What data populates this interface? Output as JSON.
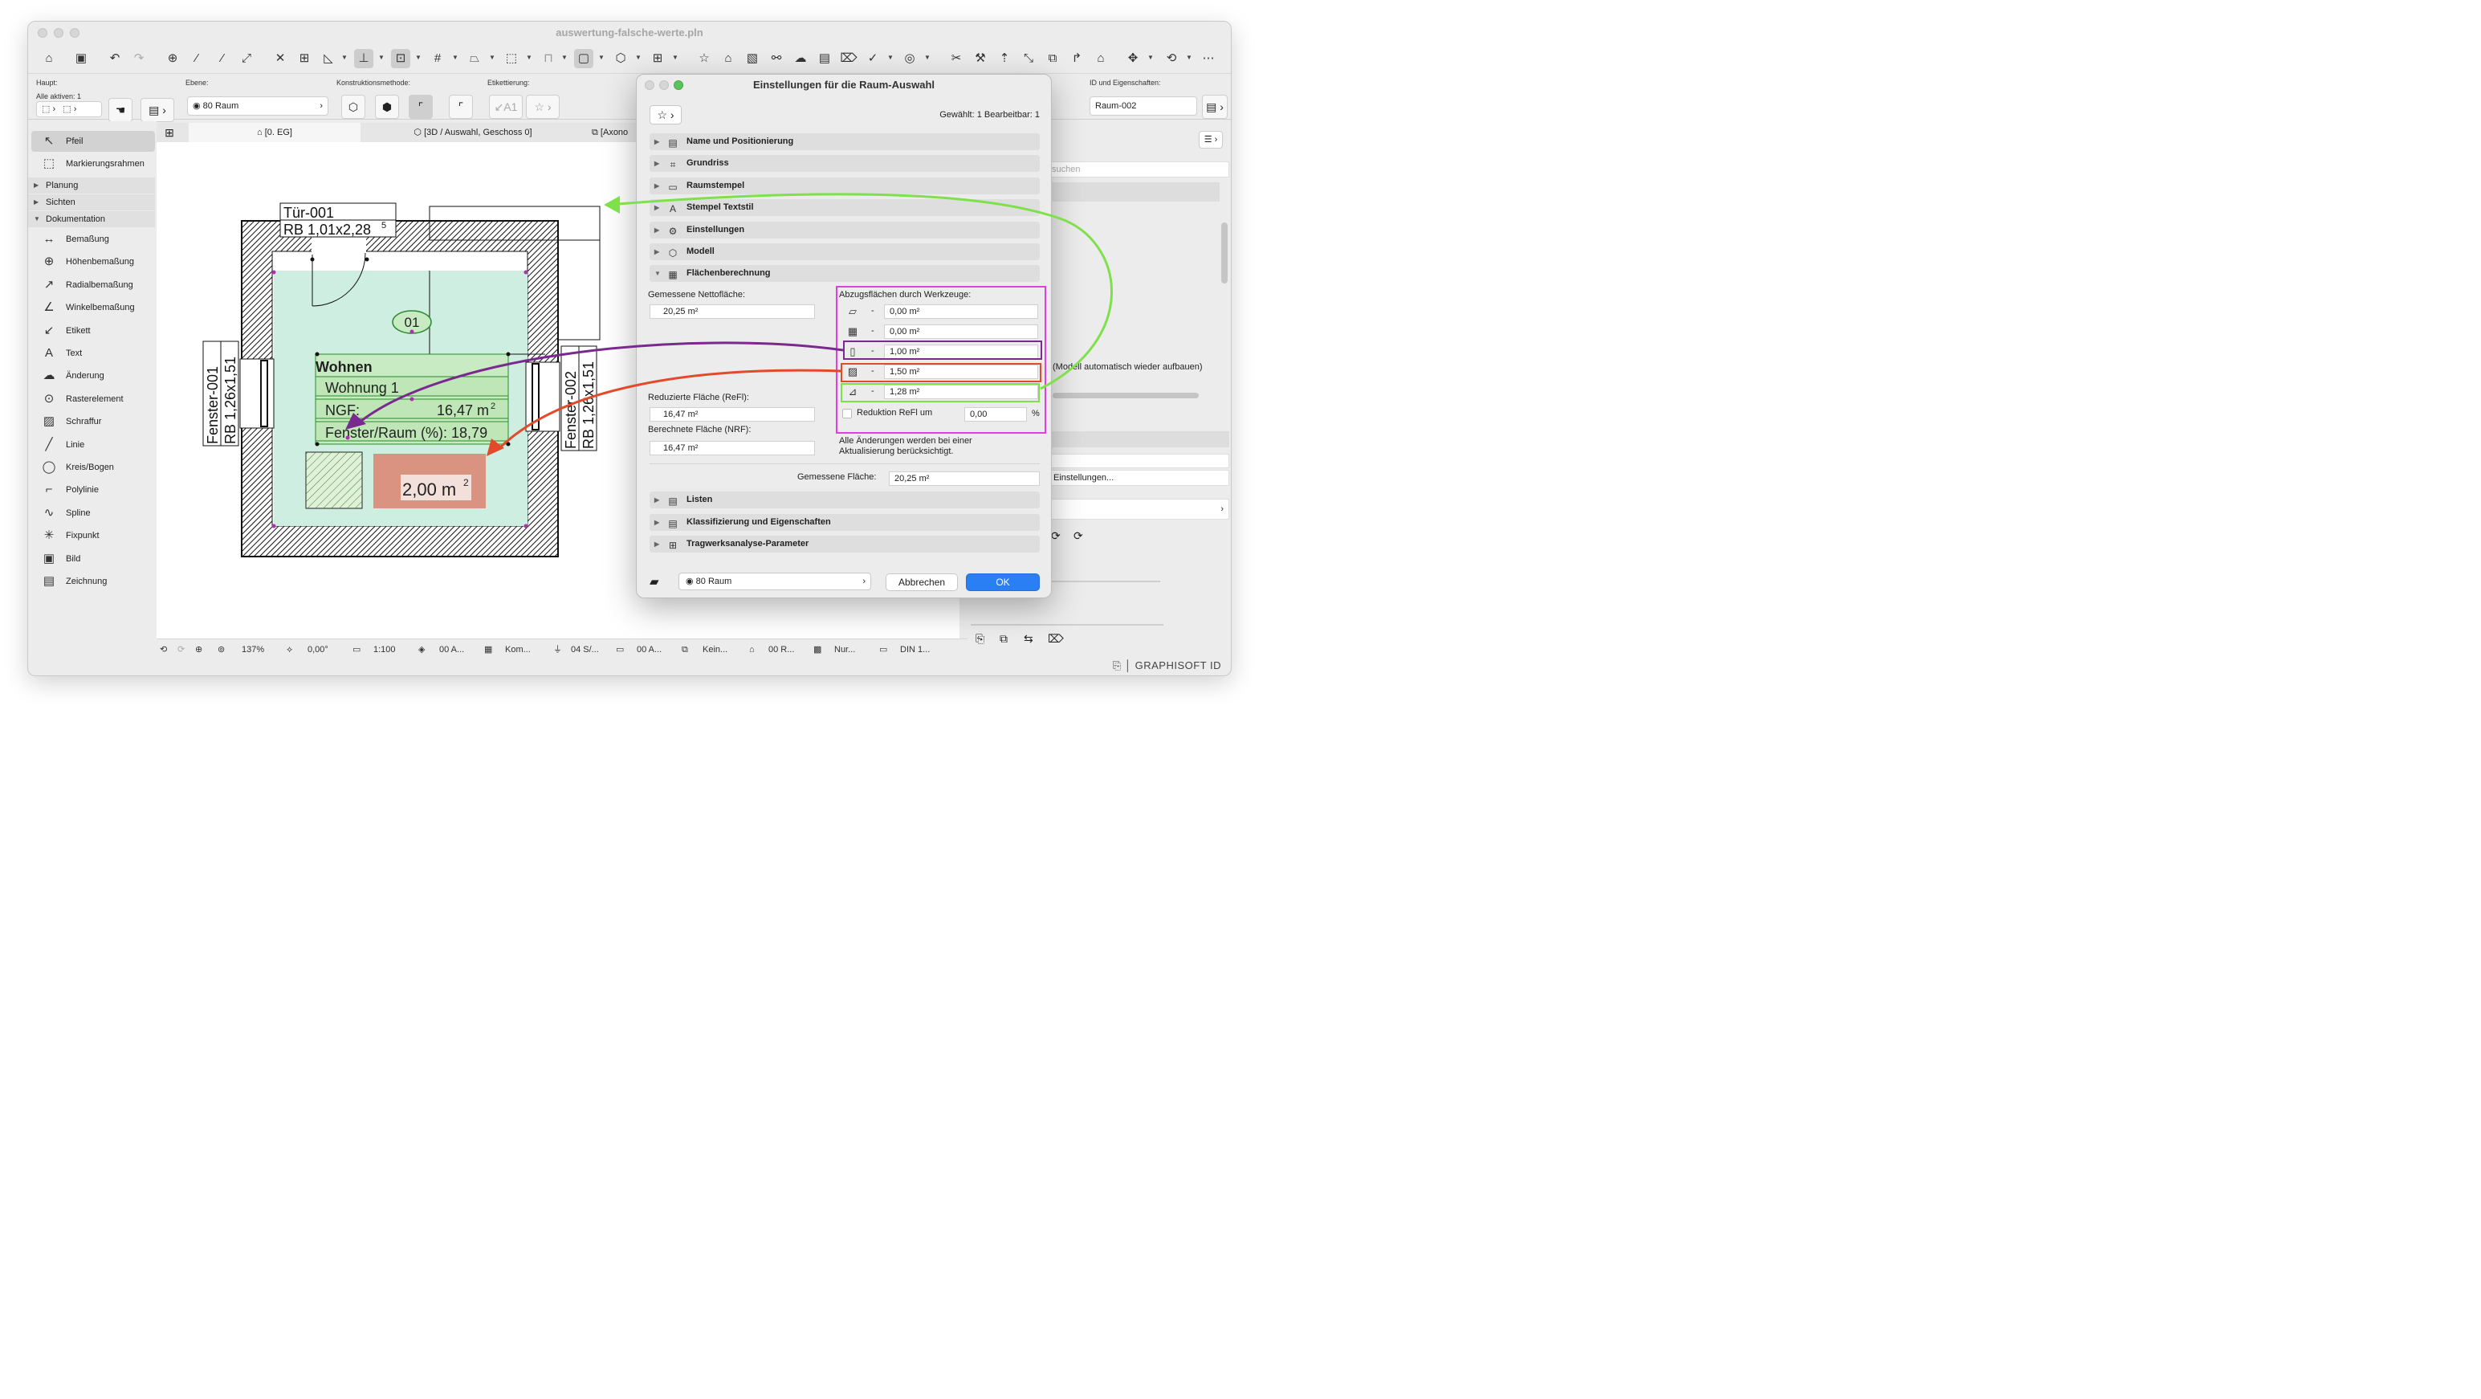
{
  "window": {
    "title": "auswertung-falsche-werte.pln"
  },
  "infobar": {
    "haupt_label": "Haupt:",
    "alle_aktiven": "Alle aktiven: 1",
    "ebene_label": "Ebene:",
    "ebene_value": "80 Raum",
    "konstruktion_label": "Konstruktionsmethode:",
    "etikett_label": "Etikettierung:",
    "id_label": "ID und Eigenschaften:",
    "id_value": "Raum-002"
  },
  "sidebar": {
    "items_top": [
      {
        "label": "Pfeil",
        "icon": "arrow-icon"
      },
      {
        "label": "Markierungsrahmen",
        "icon": "marquee-icon"
      }
    ],
    "groups": [
      "Planung",
      "Sichten",
      "Dokumentation"
    ],
    "tools": [
      {
        "label": "Bemaßung",
        "glyph": "↔"
      },
      {
        "label": "Höhenbemaßung",
        "glyph": "⊕"
      },
      {
        "label": "Radialbemaßung",
        "glyph": "↗"
      },
      {
        "label": "Winkelbemaßung",
        "glyph": "∠"
      },
      {
        "label": "Etikett",
        "glyph": "↙"
      },
      {
        "label": "Text",
        "glyph": "A"
      },
      {
        "label": "Änderung",
        "glyph": "☁"
      },
      {
        "label": "Rasterelement",
        "glyph": "⊙"
      },
      {
        "label": "Schraffur",
        "glyph": "▨"
      },
      {
        "label": "Linie",
        "glyph": "╱"
      },
      {
        "label": "Kreis/Bogen",
        "glyph": "◯"
      },
      {
        "label": "Polylinie",
        "glyph": "⌐"
      },
      {
        "label": "Spline",
        "glyph": "∿"
      },
      {
        "label": "Fixpunkt",
        "glyph": "✳"
      },
      {
        "label": "Bild",
        "glyph": "▣"
      },
      {
        "label": "Zeichnung",
        "glyph": "▤"
      }
    ]
  },
  "tabs": [
    {
      "label": "[0. EG]"
    },
    {
      "label": "[3D / Auswahl, Geschoss 0]"
    },
    {
      "label": "[Axono"
    }
  ],
  "drawing": {
    "door_id": "Tür-001",
    "door_size_base": "RB  1,01x2,28",
    "door_size_sup": "5",
    "window1_id": "Fenster-001",
    "window1_size": "RB 1,26x1,51",
    "window2_id": "Fenster-002",
    "window2_size": "RB 1,26x1,51",
    "room_number": "01",
    "room_name": "Wohnen",
    "room_sub": "Wohnung 1",
    "ngf_label": "NGF:",
    "ngf_value": "16,47 m",
    "ngf_sup": "2",
    "fenster_raum": "Fenster/Raum (%): 18,79",
    "area_value": "2,00 m",
    "area_sup": "2"
  },
  "statusbar": {
    "zoom": "137%",
    "angle": "0,00°",
    "scale": "1:100",
    "layer": "00 A...",
    "kom": "Kom...",
    "s1": "04 S/...",
    "s2": "00 A...",
    "kein": "Kein...",
    "r": "00 R...",
    "nur": "Nur...",
    "din": "DIN 1..."
  },
  "rpanel": {
    "search_placeholder": "suchen",
    "model_text": "(Modell automatisch wieder aufbauen)",
    "einstellungen": "Einstellungen..."
  },
  "dialog": {
    "title": "Einstellungen für die Raum-Auswahl",
    "gewaehlt": "Gewählt: 1 Bearbeitbar: 1",
    "sections_top": [
      {
        "label": "Name und Positionierung",
        "icon": "▤"
      },
      {
        "label": "Grundriss",
        "icon": "⌗"
      },
      {
        "label": "Raumstempel",
        "icon": "▭"
      },
      {
        "label": "Stempel Textstil",
        "icon": "A"
      },
      {
        "label": "Einstellungen",
        "icon": "⚙"
      },
      {
        "label": "Modell",
        "icon": "⬡"
      },
      {
        "label": "Flächenberechnung",
        "icon": "▦"
      }
    ],
    "gemessene_netto_label": "Gemessene Nettofläche:",
    "gemessene_netto_value": "20,25 m²",
    "abzug_label": "Abzugsflächen durch Werkzeuge:",
    "abzug_values": [
      "0,00 m²",
      "0,00 m²",
      "1,00 m²",
      "1,50 m²",
      "1,28 m²"
    ],
    "abzug_icons": [
      "▱",
      "▦",
      "▯",
      "▨",
      "⊿"
    ],
    "dash": "-",
    "reduziert_label": "Reduzierte Fläche (ReFl):",
    "reduziert_value": "16,47 m²",
    "berechnet_label": "Berechnete Fläche (NRF):",
    "berechnet_value": "16,47 m²",
    "reduktion_label": "Reduktion ReFl um",
    "reduktion_value": "0,00",
    "percent": "%",
    "hinweis_line1": "Alle Änderungen werden bei einer",
    "hinweis_line2": "Aktualisierung berücksichtigt.",
    "gemessene_flaeche_label": "Gemessene Fläche:",
    "gemessene_flaeche_value": "20,25 m²",
    "sections_bottom": [
      {
        "label": "Listen",
        "icon": "▤"
      },
      {
        "label": "Klassifizierung und Eigenschaften",
        "icon": "▤"
      },
      {
        "label": "Tragwerksanalyse-Parameter",
        "icon": "⊞"
      }
    ],
    "layer_value": "80 Raum",
    "cancel": "Abbrechen",
    "ok": "OK"
  },
  "footer": {
    "brand": "GRAPHISOFT ID"
  },
  "colors": {
    "magenta": "#e040e0",
    "purple": "#7a2a8e",
    "red": "#e24a2a",
    "green": "#7ee04a",
    "room_fill": "#cdeee0",
    "deduct_fill": "#d99380"
  }
}
